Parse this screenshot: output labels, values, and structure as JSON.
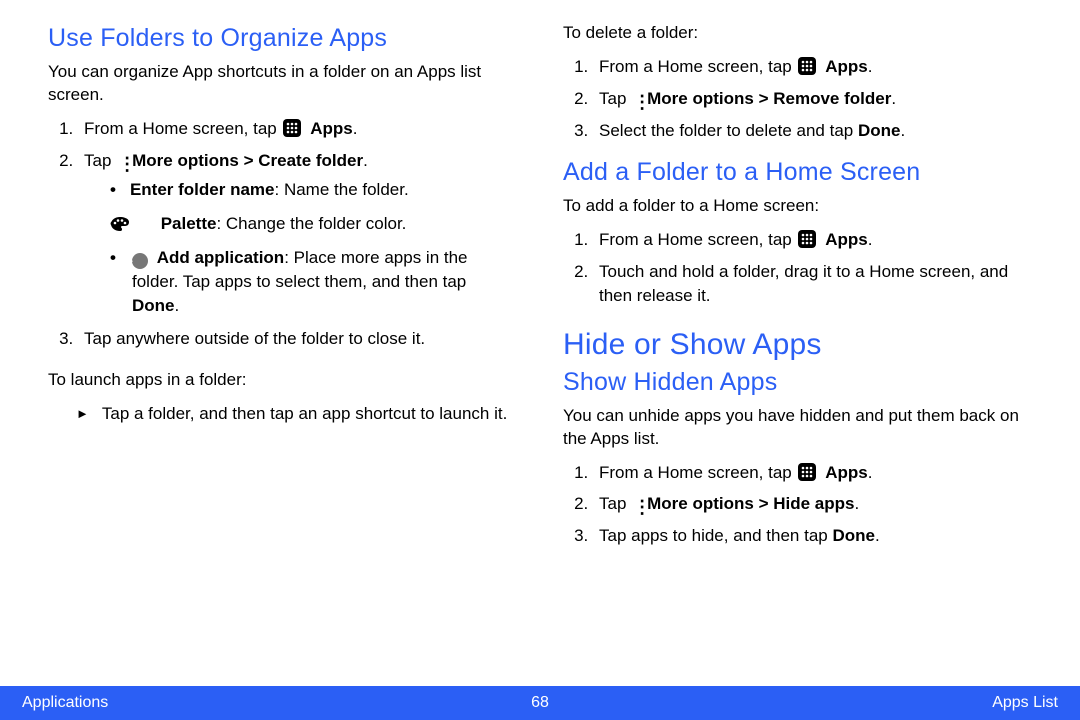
{
  "left": {
    "h_folders": "Use Folders to Organize Apps",
    "p_intro": "You can organize App shortcuts in a folder on an Apps list screen.",
    "ol1": {
      "li1a": "From a Home screen, tap ",
      "li1b": "Apps",
      "li1c": ".",
      "li2a": "Tap ",
      "li2b": "More options > Create folder",
      "li2c": ".",
      "b1a": "Enter folder name",
      "b1b": ": Name the folder.",
      "b2a": "Palette",
      "b2b": ": Change the folder color.",
      "b3a": "Add application",
      "b3b": ": Place more apps in the folder. Tap apps to select them, and then tap ",
      "b3c": "Done",
      "b3d": ".",
      "li3": "Tap anywhere outside of the folder to close it."
    },
    "p_launch": "To launch apps in a folder:",
    "arrow1": "Tap a folder, and then tap an app shortcut to launch it."
  },
  "right": {
    "p_delete": "To delete a folder:",
    "del": {
      "li1a": "From a Home screen, tap ",
      "li1b": "Apps",
      "li1c": ".",
      "li2a": "Tap ",
      "li2b": "More options > Remove folder",
      "li2c": ".",
      "li3a": "Select the folder to delete and tap ",
      "li3b": "Done",
      "li3c": "."
    },
    "h_add": "Add a Folder to a Home Screen",
    "p_add": "To add a folder to a Home screen:",
    "add": {
      "li1a": "From a Home screen, tap ",
      "li1b": "Apps",
      "li1c": ".",
      "li2": "Touch and hold a folder, drag it to a Home screen, and then release it."
    },
    "h_hide": "Hide or Show Apps",
    "h_show": "Show Hidden Apps",
    "p_show": "You can unhide apps you have hidden and put them back on the Apps list.",
    "show": {
      "li1a": "From a Home screen, tap ",
      "li1b": "Apps",
      "li1c": ".",
      "li2a": "Tap ",
      "li2b": "More options > Hide apps",
      "li2c": ".",
      "li3a": "Tap apps to hide, and then tap ",
      "li3b": "Done",
      "li3c": "."
    }
  },
  "footer": {
    "left": "Applications",
    "center": "68",
    "right": "Apps List"
  }
}
